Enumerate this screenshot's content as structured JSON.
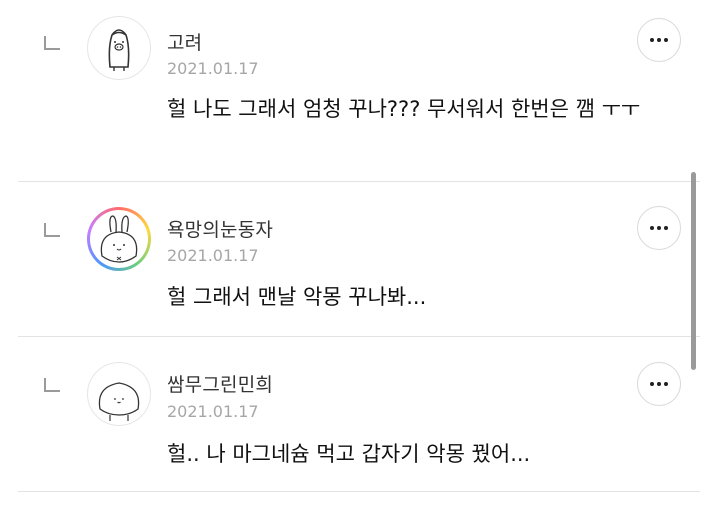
{
  "comments": [
    {
      "author": "고려",
      "date": "2021.01.17",
      "text": "헐 나도 그래서 엄청 꾸나??? 무서워서 한번은 깸 ㅜㅜ",
      "avatar_icon": "pig-penguin-avatar-icon"
    },
    {
      "author": "욕망의눈동자",
      "date": "2021.01.17",
      "text": "헐 그래서 맨날 악몽 꾸나봐...",
      "avatar_icon": "bunny-avatar-icon"
    },
    {
      "author": "쌈무그린민희",
      "date": "2021.01.17",
      "text": "헐.. 나 마그네슘 먹고 갑자기 악몽 꿨어...",
      "avatar_icon": "blob-face-avatar-icon"
    }
  ],
  "colors": {
    "text": "#111111",
    "author": "#333333",
    "date": "#a6a6a6",
    "divider": "#e3e3e3"
  }
}
